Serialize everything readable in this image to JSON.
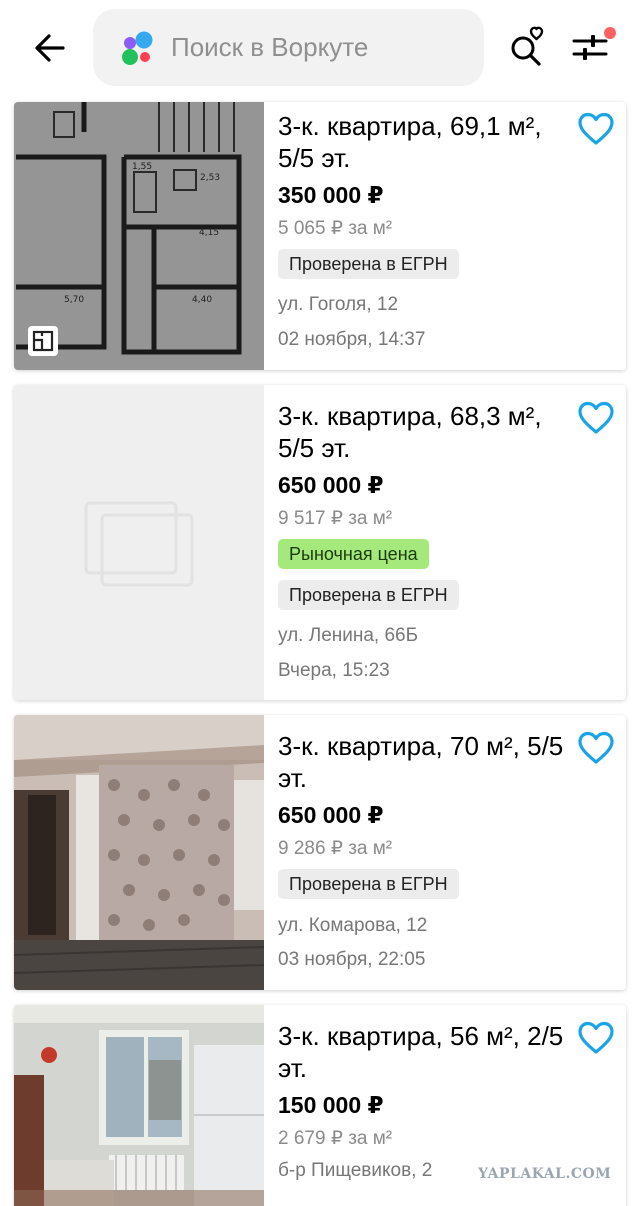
{
  "header": {
    "back_icon": "arrow-left-icon",
    "search_placeholder": "Поиск в Воркуте",
    "saved_search_icon": "search-heart-icon",
    "filter_icon": "sliders-icon",
    "filter_indicator_color": "#ff6163"
  },
  "listings": [
    {
      "title": "3-к. квартира, 69,1 м², 5/5 эт.",
      "price": "350 000 ₽",
      "price_per_sqm": "5 065 ₽ за м²",
      "badges": [
        "Проверена в ЕГРН"
      ],
      "address": "ул. Гоголя, 12",
      "date": "02 ноября, 14:37",
      "photo": "floor-plan"
    },
    {
      "title": "3-к. квартира, 68,3 м², 5/5 эт.",
      "price": "650 000 ₽",
      "price_per_sqm": "9 517 ₽ за м²",
      "badges": [
        "Рыночная цена",
        "Проверена в ЕГРН"
      ],
      "address": "ул. Ленина, 66Б",
      "date": "Вчера, 15:23",
      "photo": "placeholder"
    },
    {
      "title": "3-к. квартира, 70 м², 5/5 эт.",
      "price": "650 000 ₽",
      "price_per_sqm": "9 286 ₽ за м²",
      "badges": [
        "Проверена в ЕГРН"
      ],
      "address": "ул. Комарова, 12",
      "date": "03 ноября, 22:05",
      "photo": "hallway-interior"
    },
    {
      "title": "3-к. квартира, 56 м², 2/5 эт.",
      "price": "150 000 ₽",
      "price_per_sqm": "2 679 ₽ за м²",
      "badges": [],
      "address": "б-р Пищевиков, 2",
      "date": "",
      "photo": "kitchen-interior"
    }
  ],
  "colors": {
    "favorite_icon": "#1aa4e8",
    "market_price_badge": "#a5e87b",
    "verified_badge": "#ececec"
  },
  "watermark": "YAPLAKAL.COM"
}
